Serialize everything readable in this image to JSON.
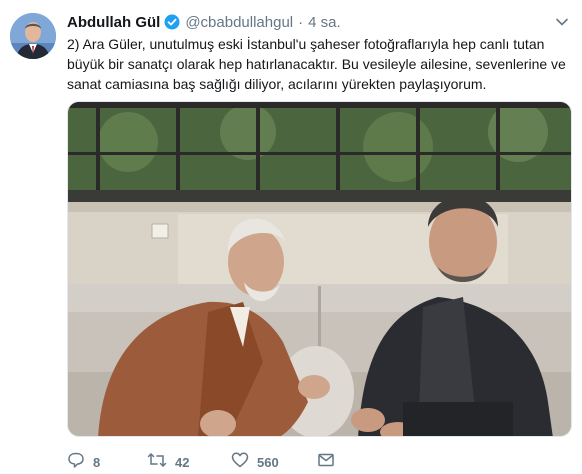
{
  "author": {
    "name": "Abdullah Gül",
    "handle": "@cbabdullahgul",
    "separator": "·",
    "time": "4 sa."
  },
  "tweet": {
    "lines": [
      "2) Ara Güler, unutulmuş eski İstanbul'u şaheser fotoğraflarıyla hep canlı tutan",
      "büyük bir sanatçı olarak hep hatırlanacaktır.  Bu vesileyle ailesine, sevenlerine ve",
      "sanat camiasına baş sağlığı diliyor, acılarını yürekten paylaşıyorum."
    ]
  },
  "actions": {
    "replies": "8",
    "retweets": "42",
    "likes": "560"
  },
  "icons": {
    "verified": "verified-badge-icon",
    "caret": "chevron-down-icon",
    "reply": "reply-icon",
    "retweet": "retweet-icon",
    "like": "heart-icon",
    "dm": "envelope-icon"
  },
  "colors": {
    "text": "#14171a",
    "muted": "#657786",
    "verified": "#1da1f2"
  }
}
